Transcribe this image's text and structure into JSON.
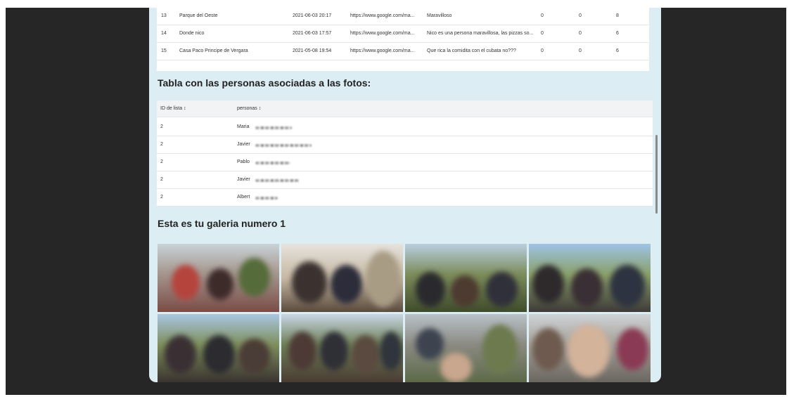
{
  "visits_table": {
    "rows": [
      {
        "id": "13",
        "name": "Parque del Oeste",
        "date": "2021-06-03 20:17",
        "url": "https://www.google.com/ma...",
        "comment": "Maravilloso",
        "c1": "0",
        "c2": "0",
        "c3": "8"
      },
      {
        "id": "14",
        "name": "Donde nico",
        "date": "2021-06-03 17:57",
        "url": "https://www.google.com/ma...",
        "comment": "Nico es una persona maravillosa, las pizzas so...",
        "c1": "0",
        "c2": "0",
        "c3": "6"
      },
      {
        "id": "15",
        "name": "Casa Paco Principe de Vergara",
        "date": "2021-05-08 19:54",
        "url": "https://www.google.com/ma...",
        "comment": "Que rica la comidita con el cubata no???",
        "c1": "0",
        "c2": "0",
        "c3": "6"
      }
    ]
  },
  "people_section": {
    "title": "Tabla con las personas asociadas a las fotos:",
    "columns": [
      "ID de lista ↕",
      "personas ↕"
    ],
    "rows": [
      {
        "id": "2",
        "name": "Maria"
      },
      {
        "id": "2",
        "name": "Javier"
      },
      {
        "id": "2",
        "name": "Pablo"
      },
      {
        "id": "2",
        "name": "Javier"
      },
      {
        "id": "2",
        "name": "Albert"
      }
    ]
  },
  "gallery_section": {
    "title": "Esta es tu galeria numero 1",
    "photo_count": 8
  },
  "colors": {
    "page_background": "#262626",
    "panel_background": "#dceef3",
    "table_background": "#ffffff",
    "header_background": "#f2f3f4"
  }
}
